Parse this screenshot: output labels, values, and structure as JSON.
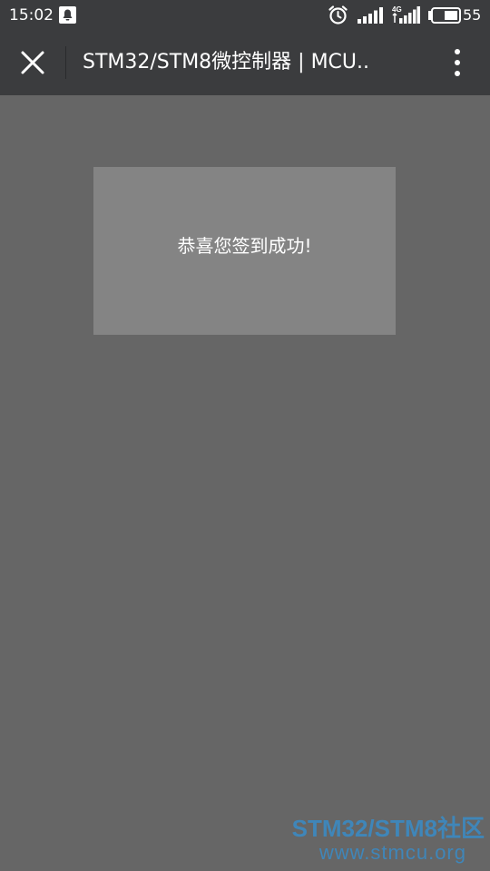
{
  "status_bar": {
    "time": "15:02",
    "battery_level": "55",
    "network_type": "4G",
    "icons": [
      "notification-icon",
      "alarm-icon",
      "signal-icon",
      "signal-4g-icon",
      "battery-icon"
    ]
  },
  "title_bar": {
    "title": "STM32/STM8微控制器 | MCU..",
    "close_icon": "close-icon",
    "more_icon": "more-vertical-icon"
  },
  "toast": {
    "message": "恭喜您签到成功!"
  },
  "watermark": {
    "brand": "STM32/STM8社区",
    "url": "www.stmcu.org"
  },
  "colors": {
    "bar_background": "#3b3c3e",
    "page_overlay": "#666666",
    "toast_background": "#848484",
    "watermark": "#3f86b9"
  }
}
